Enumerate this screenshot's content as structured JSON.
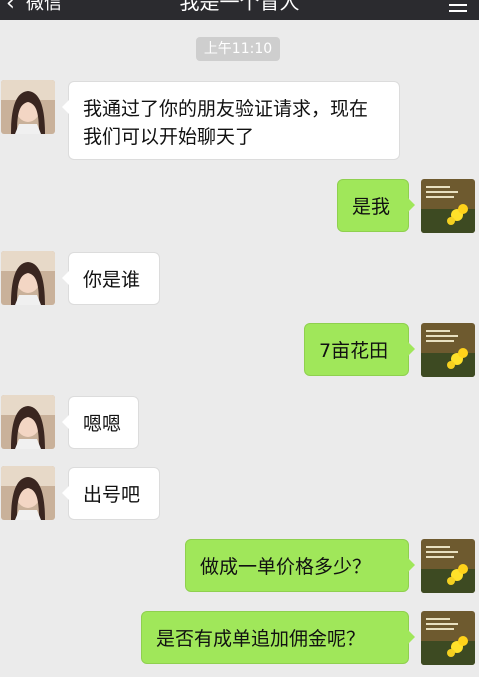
{
  "header": {
    "back_glyph": "‹",
    "back_label": "微信",
    "title": "我是一个盲人",
    "menu_icon": "hamburger-icon"
  },
  "timestamp": "上午11:10",
  "colors": {
    "background": "#ebebeb",
    "incoming_bubble": "#ffffff",
    "outgoing_bubble": "#a0e75a",
    "timestamp_badge": "#cecece",
    "header": "#2b2b2f"
  },
  "messages": [
    {
      "side": "in",
      "text": "我通过了你的朋友验证请求，现在我们可以开始聊天了"
    },
    {
      "side": "out",
      "text": "是我"
    },
    {
      "side": "in",
      "text": "你是谁"
    },
    {
      "side": "out",
      "text": "7亩花田"
    },
    {
      "side": "in",
      "text": "嗯嗯"
    },
    {
      "side": "in",
      "text": "出号吧"
    },
    {
      "side": "out",
      "text": "做成一单价格多少？"
    },
    {
      "side": "out",
      "text": "是否有成单追加佣金呢？"
    }
  ]
}
